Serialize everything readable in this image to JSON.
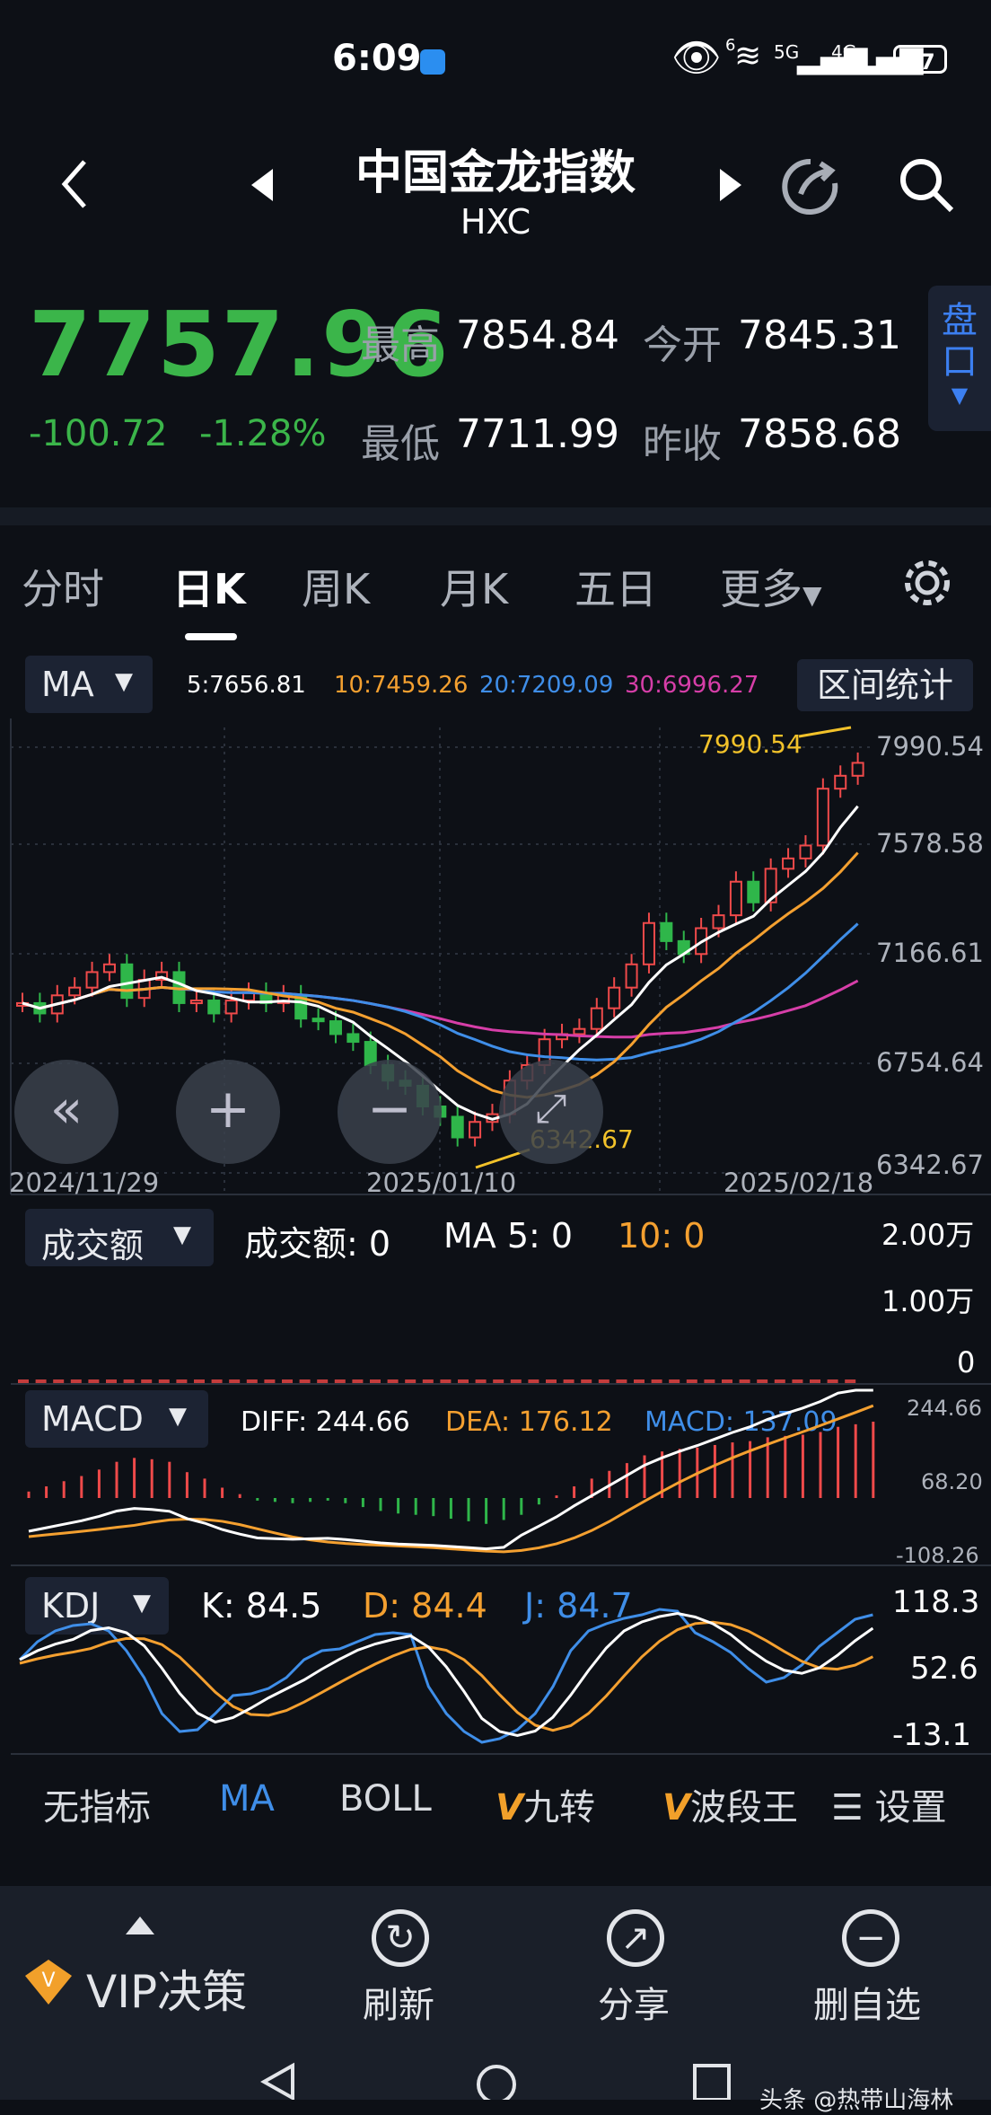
{
  "status_bar": {
    "time": "6:09",
    "battery": "87",
    "sig_5g": "5G",
    "sig_4g": "4G",
    "wifi_6": "6"
  },
  "header": {
    "title": "中国金龙指数",
    "code": "HXC"
  },
  "quote": {
    "price": "7757.96",
    "change": "-100.72",
    "change_pct": "-1.28%",
    "high_label": "最高",
    "high": "7854.84",
    "open_label": "今开",
    "open": "7845.31",
    "low_label": "最低",
    "low": "7711.99",
    "prev_label": "昨收",
    "prev": "7858.68",
    "pankou": "盘口"
  },
  "tabs": [
    "分时",
    "日K",
    "周K",
    "月K",
    "五日",
    "更多"
  ],
  "active_tab": "日K",
  "ma": {
    "selector": "MA",
    "range_stat": "区间统计",
    "ma5": "5:7656.81",
    "ma10": "10:7459.26",
    "ma20": "20:7209.09",
    "ma30": "30:6996.27"
  },
  "candle_axis": {
    "y_ticks": [
      "7990.54",
      "7578.58",
      "7166.61",
      "6754.64",
      "6342.67"
    ],
    "max_label": "7990.54",
    "min_label": "6342.67",
    "dates": [
      "2024/11/29",
      "2025/01/10",
      "2025/02/18"
    ]
  },
  "volume": {
    "selector": "成交额",
    "text1": "成交额: 0",
    "text2": "MA 5: 0",
    "text3": "10: 0",
    "y_ticks": [
      "2.00万",
      "1.00万",
      "0"
    ]
  },
  "macd": {
    "selector": "MACD",
    "diff": "DIFF: 244.66",
    "dea": "DEA: 176.12",
    "macd": "MACD: 137.09",
    "y_ticks": [
      "244.66",
      "68.20",
      "-108.26"
    ]
  },
  "kdj": {
    "selector": "KDJ",
    "k": "K: 84.5",
    "d": "D: 84.4",
    "j": "J: 84.7",
    "y_ticks": [
      "118.3",
      "52.6",
      "-13.1"
    ]
  },
  "indicator_bar": {
    "none": "无指标",
    "ma": "MA",
    "boll": "BOLL",
    "jiuzhuan": "九转",
    "boduan": "波段王",
    "settings": "设置"
  },
  "bottom_bar": {
    "vip": "VIP决策",
    "refresh": "刷新",
    "share": "分享",
    "delete": "删自选"
  },
  "watermark": "头条 @热带山海林",
  "colors": {
    "up": "#ef4a4a",
    "down": "#2fb64a",
    "ma5": "#ffffff",
    "ma10": "#f4a030",
    "ma20": "#3f8ee8",
    "ma30": "#d63ea8",
    "yellow": "#f2c22a"
  },
  "chart_data": {
    "type": "candlestick",
    "x": [
      "2024/11/29",
      "2025/01/10",
      "2025/02/18"
    ],
    "ylim": [
      6342.67,
      7990.54
    ],
    "max_point": 7990.54,
    "min_point": 6342.67
  }
}
